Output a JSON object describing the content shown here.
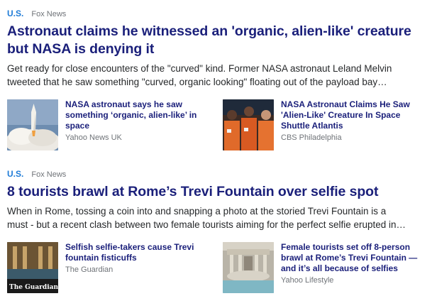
{
  "stories": [
    {
      "category": "U.S.",
      "source": "Fox News",
      "headline_line1": "Astronaut claims he witnessed an 'organic, alien-like' creature",
      "headline_line2": "but NASA is denying it",
      "summary_line1": "Get ready for close encounters of the \"curved\" kind. Former NASA astronaut Leland Melvin",
      "summary_line2": "tweeted that he saw something \"curved, organic looking\" floating out of the payload bay…",
      "related": [
        {
          "title": "NASA astronaut says he saw something ‘organic, alien-like’ in space",
          "source": "Yahoo News UK",
          "image": "space-shuttle-launch"
        },
        {
          "title": "NASA Astronaut Claims He Saw 'Alien-Like' Creature In Space Shuttle Atlantis",
          "source": "CBS Philadelphia",
          "image": "astronaut-crew-photo"
        }
      ]
    },
    {
      "category": "U.S.",
      "source": "Fox News",
      "headline_line1": "8 tourists brawl at Rome’s Trevi Fountain over selfie spot",
      "headline_line2": "",
      "summary_line1": "When in Rome, tossing a coin into and snapping a photo at the storied Trevi Fountain is a",
      "summary_line2": "must - but a recent clash between two female tourists aiming for the perfect selfie erupted in…",
      "related": [
        {
          "title": "Selfish selfie-takers cause Trevi fountain fisticuffs",
          "source": "The Guardian",
          "image": "trevi-fountain-night",
          "image_caption": "The Guardian"
        },
        {
          "title": "Female tourists set off 8-person brawl at Rome’s Trevi Fountain — and it’s all because of selfies",
          "source": "Yahoo Lifestyle",
          "image": "trevi-fountain-day"
        }
      ]
    }
  ],
  "colors": {
    "category": "#1e7bd7",
    "headline": "#1a1f7a",
    "source": "#6f7378",
    "summary": "#26282a"
  }
}
